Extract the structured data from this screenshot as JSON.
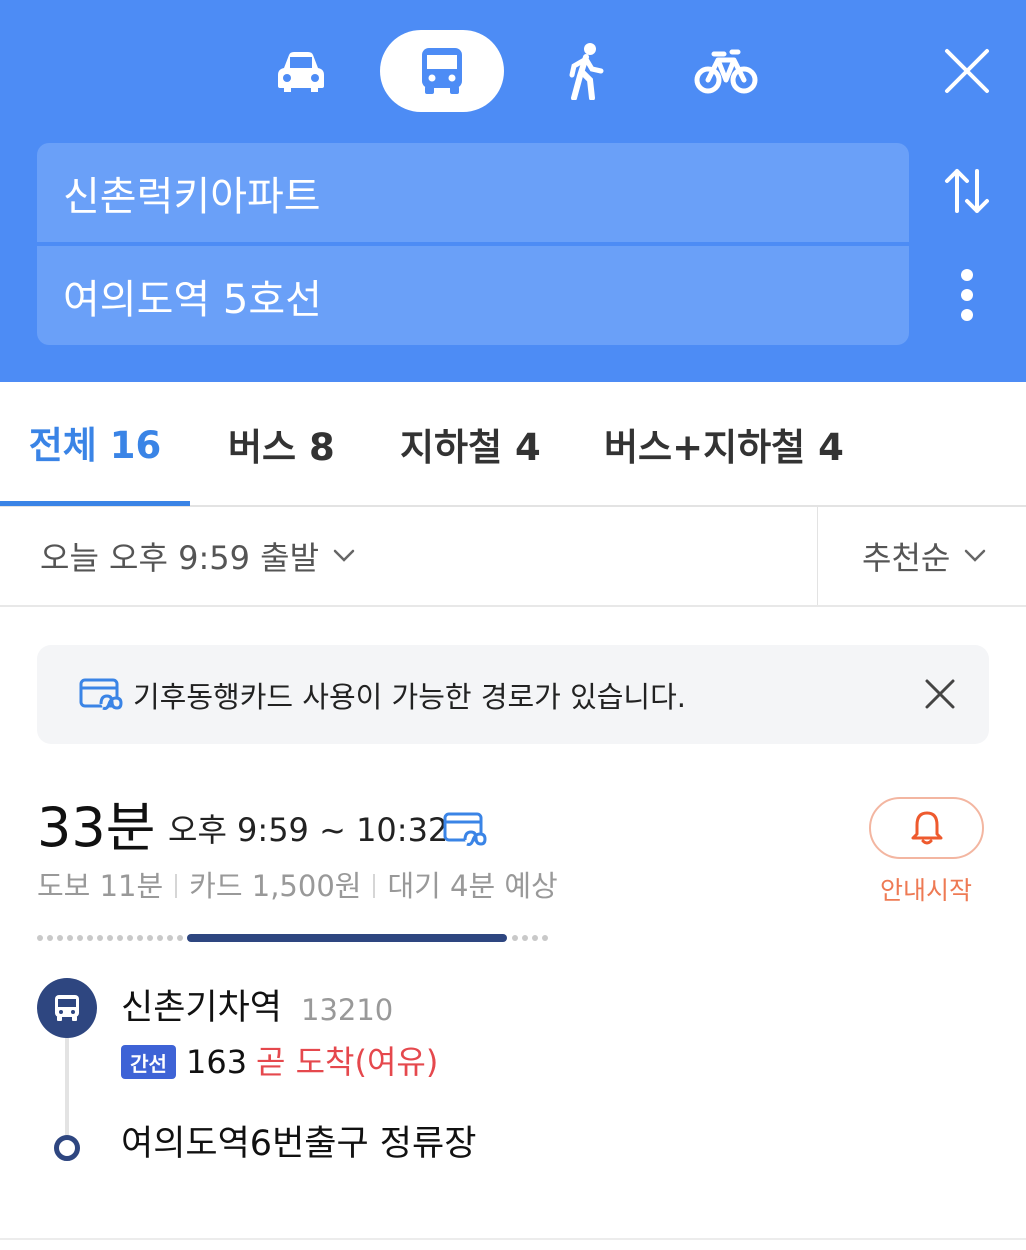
{
  "modes": [
    {
      "icon": "car-icon",
      "selected": false
    },
    {
      "icon": "bus-icon",
      "selected": true
    },
    {
      "icon": "walk-icon",
      "selected": false
    },
    {
      "icon": "bicycle-icon",
      "selected": false
    }
  ],
  "search": {
    "origin": "신촌럭키아파트",
    "destination": "여의도역 5호선"
  },
  "tabs": {
    "all": "전체 16",
    "bus": "버스 8",
    "subway": "지하철 4",
    "mixed": "버스+지하철 4"
  },
  "filters": {
    "departure": "오늘 오후 9:59 출발",
    "sort": "추천순"
  },
  "notice": {
    "text": "기후동행카드 사용이 가능한 경로가 있습니다."
  },
  "route": {
    "duration": "33분",
    "timespan": "오후 9:59 ~ 10:32",
    "walk": "도보 11분",
    "fare": "카드 1,500원",
    "wait": "대기 4분 예상",
    "alarm_label": "안내시작",
    "steps": {
      "start_stop": "신촌기차역",
      "start_stop_id": "13210",
      "bus_type": "간선",
      "bus_number": "163",
      "arrival_status": "곧 도착(여유)",
      "end_stop": "여의도역6번출구 정류장"
    }
  },
  "colors": {
    "header_bg": "#4d8cf5",
    "accent_blue": "#3a84e6",
    "bus_navy": "#2e4680",
    "arrival_red": "#e5484d",
    "alarm_orange": "#ee7a54"
  }
}
